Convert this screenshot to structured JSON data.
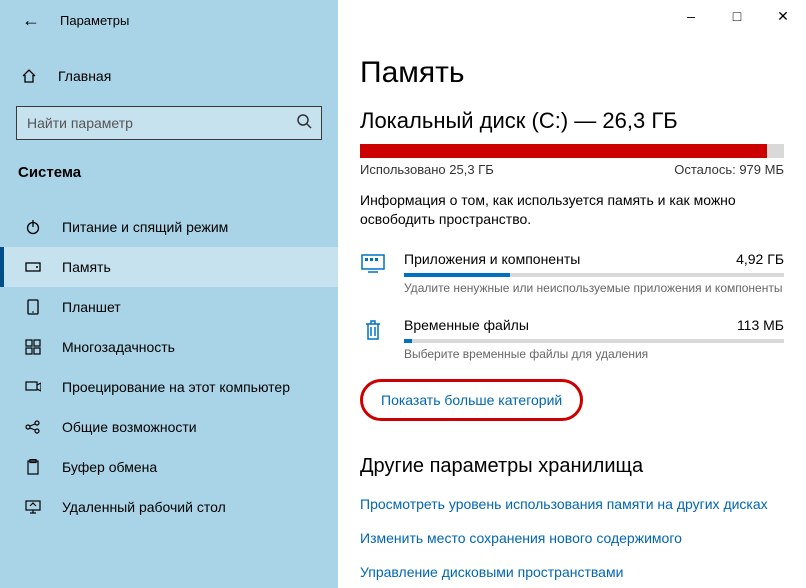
{
  "window": {
    "title": "Параметры"
  },
  "sidebar": {
    "home": "Главная",
    "search_placeholder": "Найти параметр",
    "section": "Система",
    "items": [
      {
        "icon": "power",
        "label": "Питание и спящий режим"
      },
      {
        "icon": "storage",
        "label": "Память"
      },
      {
        "icon": "tablet",
        "label": "Планшет"
      },
      {
        "icon": "multitask",
        "label": "Многозадачность"
      },
      {
        "icon": "project",
        "label": "Проецирование на этот компьютер"
      },
      {
        "icon": "shared",
        "label": "Общие возможности"
      },
      {
        "icon": "clipboard",
        "label": "Буфер обмена"
      },
      {
        "icon": "remote",
        "label": "Удаленный рабочий стол"
      }
    ]
  },
  "main": {
    "title": "Память",
    "disk_label": "Локальный диск (C:) — 26,3 ГБ",
    "used_label": "Использовано 25,3 ГБ",
    "free_label": "Осталось: 979 МБ",
    "used_pct": 96,
    "info": "Информация о том, как используется память и как можно освободить пространство.",
    "categories": [
      {
        "icon": "apps",
        "name": "Приложения и компоненты",
        "size": "4,92 ГБ",
        "pct": 28,
        "hint": "Удалите ненужные или неиспользуемые приложения и компоненты"
      },
      {
        "icon": "trash",
        "name": "Временные файлы",
        "size": "113 МБ",
        "pct": 2,
        "hint": "Выберите временные файлы для удаления"
      }
    ],
    "show_more": "Показать больше категорий",
    "other_title": "Другие параметры хранилища",
    "links": [
      "Просмотреть уровень использования памяти на других дисках",
      "Изменить место сохранения нового содержимого",
      "Управление дисковыми пространствами"
    ]
  }
}
